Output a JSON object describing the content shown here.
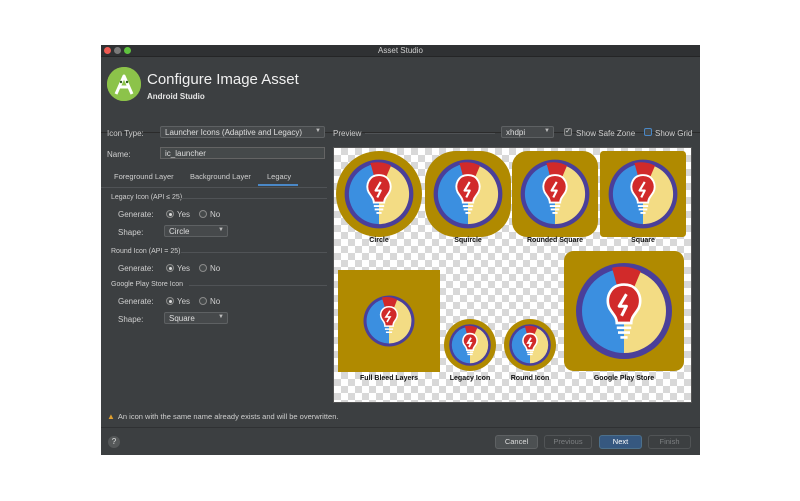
{
  "window": {
    "title": "Asset Studio"
  },
  "header": {
    "title": "Configure Image Asset",
    "subtitle": "Android Studio"
  },
  "form": {
    "icon_type_label": "Icon Type:",
    "icon_type_value": "Launcher Icons (Adaptive and Legacy)",
    "name_label": "Name:",
    "name_value": "ic_launcher"
  },
  "tabs": [
    {
      "label": "Foreground Layer",
      "selected": false
    },
    {
      "label": "Background Layer",
      "selected": false
    },
    {
      "label": "Legacy",
      "selected": true
    }
  ],
  "legacy_section": {
    "title": "Legacy Icon (API ≤ 25)",
    "generate_label": "Generate:",
    "yes_label": "Yes",
    "no_label": "No",
    "generate_selected": "Yes",
    "shape_label": "Shape:",
    "shape_value": "Circle"
  },
  "round_section": {
    "title": "Round Icon (API = 25)",
    "generate_label": "Generate:",
    "yes_label": "Yes",
    "no_label": "No",
    "generate_selected": "Yes"
  },
  "play_section": {
    "title": "Google Play Store Icon",
    "generate_label": "Generate:",
    "yes_label": "Yes",
    "no_label": "No",
    "generate_selected": "Yes",
    "shape_label": "Shape:",
    "shape_value": "Square"
  },
  "preview": {
    "label": "Preview",
    "density_value": "xhdpi",
    "show_safe_zone_label": "Show Safe Zone",
    "show_safe_zone_checked": true,
    "show_grid_label": "Show Grid",
    "show_grid_checked": false,
    "icons": {
      "circle": "Circle",
      "squircle": "Squircle",
      "rounded_square": "Rounded Square",
      "square": "Square",
      "full_bleed": "Full Bleed Layers",
      "legacy": "Legacy Icon",
      "round": "Round Icon",
      "play_store": "Google Play Store"
    }
  },
  "warning": "An icon with the same name already exists and will be overwritten.",
  "footer": {
    "help_label": "?",
    "cancel_label": "Cancel",
    "previous_label": "Previous",
    "next_label": "Next",
    "finish_label": "Finish"
  },
  "colors": {
    "icon_background": "#b08a00",
    "gear": "#4a3f9a",
    "blue": "#3b8fe0",
    "yellow": "#f3dc84",
    "red": "#d12a2a",
    "accent": "#4a88c7"
  }
}
